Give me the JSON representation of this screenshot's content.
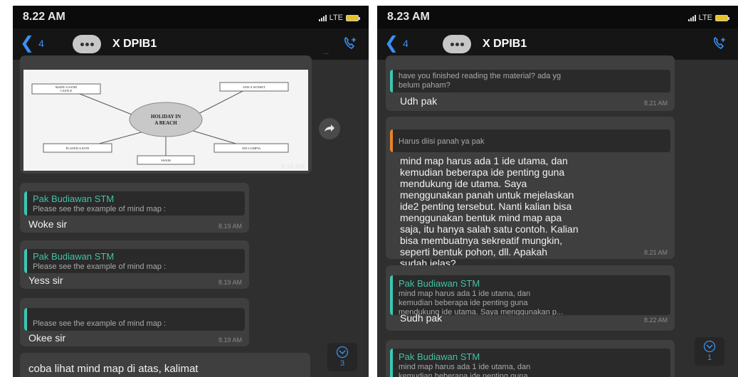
{
  "left": {
    "status": {
      "time": "8.22 AM",
      "network": "LTE"
    },
    "header": {
      "back_count": "4",
      "title": "X DPIB1"
    },
    "image_message": {
      "center": "HOLIDAY IN\nA BEACH",
      "nodes": [
        "MADE A SAND\nCASTLE",
        "SAW A SUNSET",
        "PLAYED A KITE",
        "SWAM",
        "ATE LUMPIA"
      ],
      "time": "8.18 AM"
    },
    "messages": [
      {
        "quote_name": "Pak Budiawan STM",
        "quote_text": "Please see the example of mind map :",
        "text": "Woke sir",
        "time": "8.19 AM"
      },
      {
        "quote_name": "Pak Budiawan STM",
        "quote_text": "Please see the example of mind map :",
        "text": "Yess sir",
        "time": "8.19 AM"
      },
      {
        "quote_name": "",
        "quote_text": "Please see the example of mind map :",
        "text": "Okee sir",
        "time": "8.19 AM"
      }
    ],
    "last_message": "coba lihat mind map di atas, kalimat\ndalam lingkaran menyatakan main idea",
    "scroll_badge": "3"
  },
  "right": {
    "status": {
      "time": "8.23 AM",
      "network": "LTE"
    },
    "header": {
      "back_count": "4",
      "title": "X DPIB1"
    },
    "messages": [
      {
        "quote_name": "",
        "quote_text": "have you finished reading the material? ada yg\nbelum paham?",
        "text": "Udh pak",
        "time": "8.21 AM"
      },
      {
        "quote_name": "",
        "quote_text": "Harus diisi panah ya pak",
        "text": "mind map harus ada 1 ide utama, dan\nkemudian beberapa ide penting guna\nmendukung ide utama. Saya\nmenggunakan panah untuk mejelaskan\nide2 penting tersebut. Nanti kalian bisa\nmenggunakan bentuk mind map apa\nsaja, itu hanya salah satu contoh. Kalian\nbisa membuatnya sekreatif mungkin,\nseperti bentuk pohon, dll. Apakah\nsudah jelas?",
        "time": "8.21 AM"
      },
      {
        "quote_name": "Pak Budiawan STM",
        "quote_text": "mind map harus ada 1 ide utama, dan\nkemudian beberapa ide penting guna\nmendukung ide utama. Saya menggunakan p...",
        "text": "Sudh pak",
        "time": "8.22 AM"
      },
      {
        "quote_name": "Pak Budiawan STM",
        "quote_text": "mind map harus ada 1 ide utama, dan\nkemudian beberapa ide penting guna",
        "text": "",
        "time": ""
      }
    ],
    "scroll_badge": "1"
  },
  "colors": {
    "accent": "#3b8ff0",
    "quote_name": "#42c2a4",
    "bubble": "#3f3f3f",
    "background": "#2f2f2f"
  }
}
